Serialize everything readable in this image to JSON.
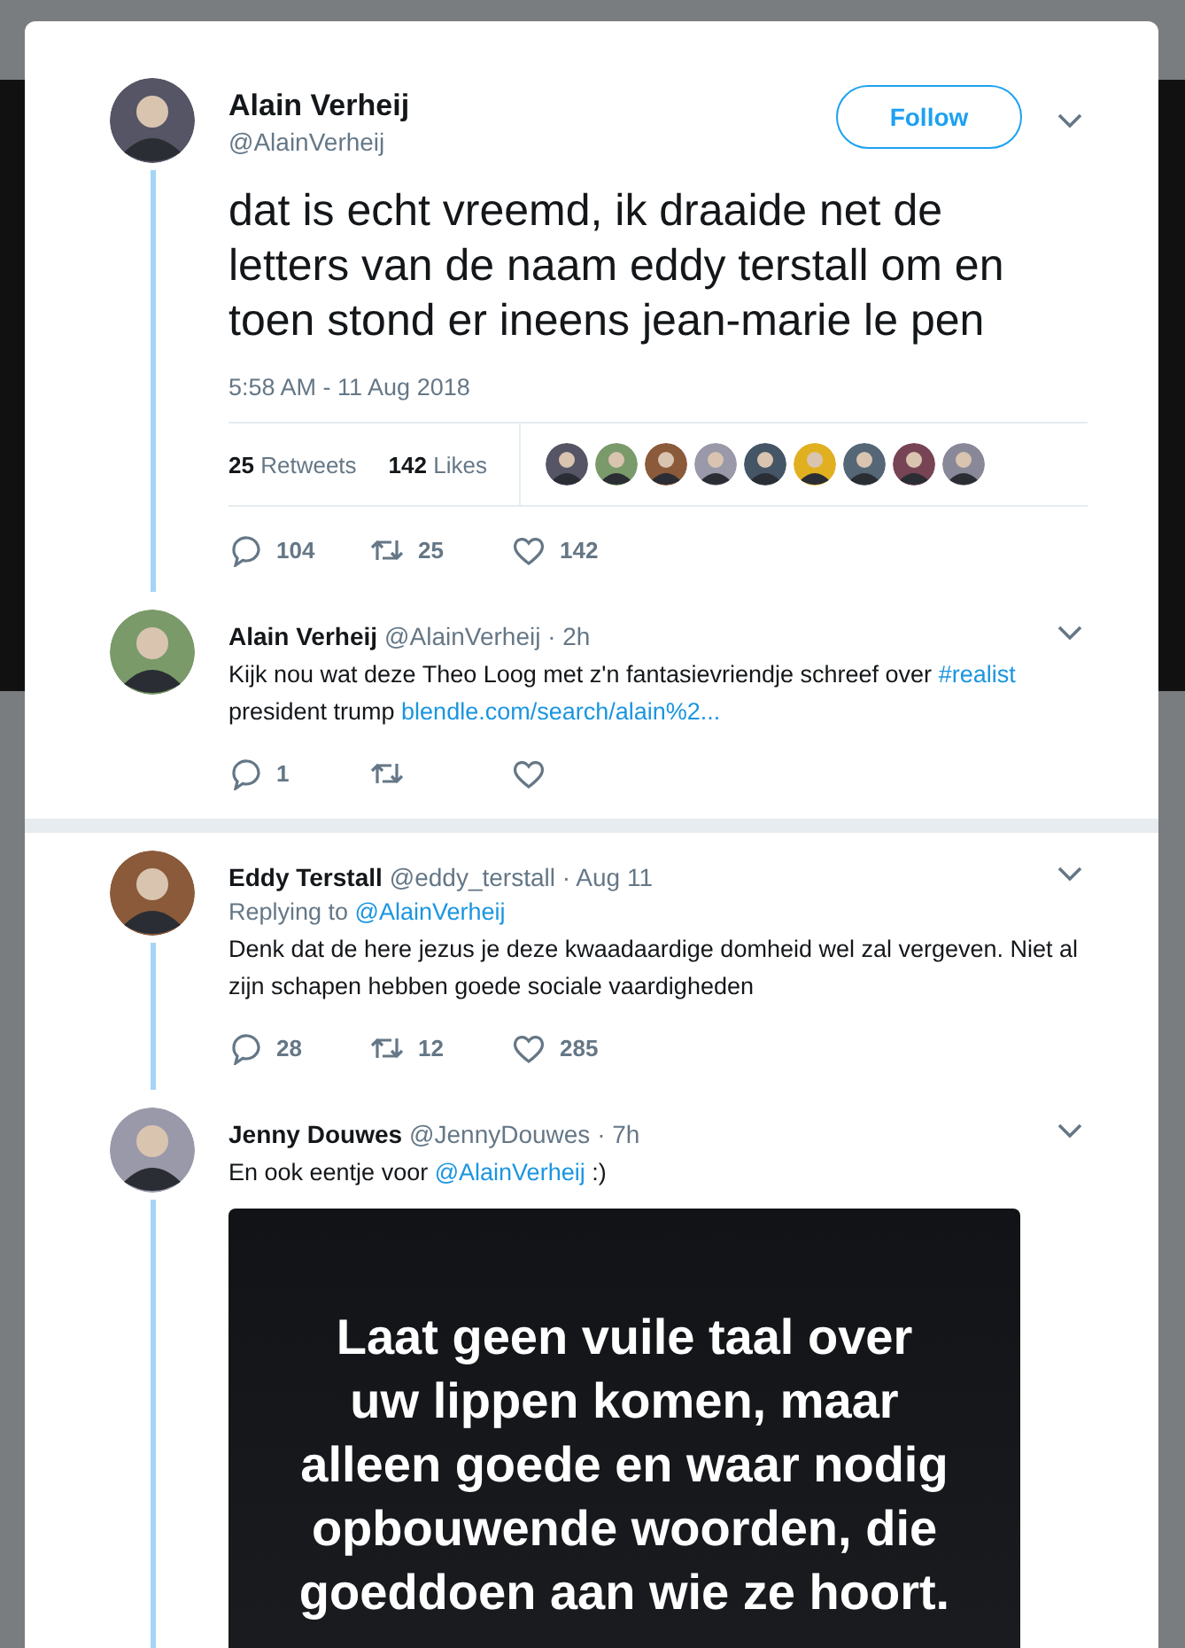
{
  "main_tweet": {
    "name": "Alain Verheij",
    "handle": "@AlainVerheij",
    "follow_button": "Follow",
    "text": "dat is echt vreemd, ik draaide net de letters van de naam eddy terstall om en toen stond er ineens jean-marie le pen",
    "timestamp": "5:58 AM - 11 Aug 2018",
    "stats": [
      {
        "count": "25",
        "label": "Retweets"
      },
      {
        "count": "142",
        "label": "Likes"
      }
    ],
    "liker_avatars": [
      {
        "kind": "avatar"
      },
      {
        "kind": "avatar"
      },
      {
        "kind": "avatar"
      },
      {
        "kind": "avatar"
      },
      {
        "kind": "avatar"
      },
      {
        "kind": "avatar"
      },
      {
        "kind": "avatar"
      },
      {
        "kind": "avatar"
      },
      {
        "kind": "avatar"
      }
    ],
    "actions": {
      "replies": "104",
      "retweets": "25",
      "likes": "142"
    }
  },
  "replies": [
    {
      "name": "Alain Verheij",
      "handle": "@AlainVerheij",
      "time": "· 2h",
      "text": "Kijk nou wat deze Theo Loog met z'n fantasievriendje schreef over ",
      "hashtag": "#realist",
      "text_2": " president trump ",
      "link": "blendle.com/search/alain%2...",
      "actions": {
        "replies": "1"
      },
      "thread_below": false,
      "separator_below": true
    },
    {
      "name": "Eddy Terstall",
      "handle": "@eddy_terstall",
      "time": "· Aug 11",
      "replying_label": "Replying to ",
      "replying_to": "@AlainVerheij",
      "text": "Denk dat de here jezus je deze kwaadaardige domheid wel zal vergeven. Niet al zijn schapen hebben goede sociale vaardigheden",
      "actions": {
        "replies": "28",
        "retweets": "12",
        "likes": "285"
      },
      "thread_below": true,
      "separator_below": false
    },
    {
      "name": "Jenny Douwes",
      "handle": "@JennyDouwes",
      "time": "· 7h",
      "text": "En ook eentje voor ",
      "mention": "@AlainVerheij",
      "text_2": " :)",
      "media_text": "Laat geen vuile taal over uw lippen komen, maar alleen goede en waar nodig opbouwende woorden, die goeddoen aan wie ze hoort.",
      "thread_below": true,
      "separator_below": false
    }
  ]
}
